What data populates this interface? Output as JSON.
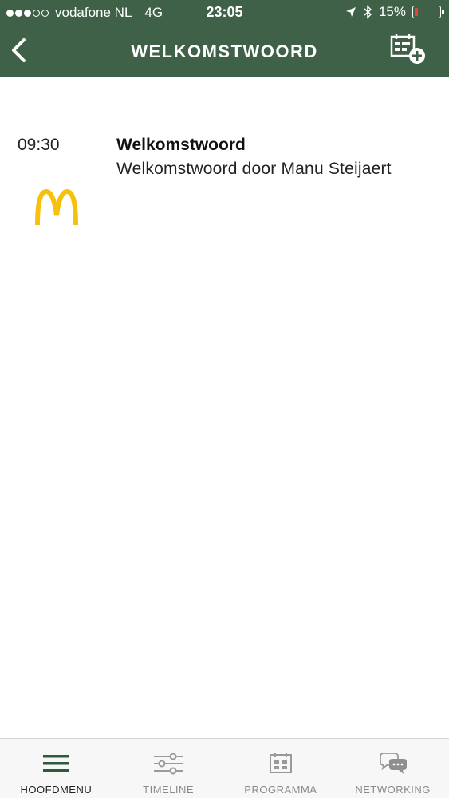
{
  "status": {
    "carrier": "vodafone NL",
    "network": "4G",
    "time": "23:05",
    "battery": "15%",
    "battery_level": 0.15,
    "signal_bars_filled": 3,
    "signal_bars_total": 5,
    "icons": [
      "location-arrow-icon",
      "bluetooth-icon",
      "battery-icon"
    ]
  },
  "nav": {
    "title": "WELKOMSTWOORD",
    "back_icon": "chevron-left-icon",
    "action_icon": "add-to-calendar-icon"
  },
  "session": {
    "time": "09:30",
    "title": "Welkomstwoord",
    "description": "Welkomstwoord door Manu Steijaert",
    "logo_icon": "mcdonalds-arches-logo",
    "logo_color": "#f6c10d"
  },
  "tabs": [
    {
      "label": "HOOFDMENU",
      "icon": "hamburger-menu-icon",
      "active": true
    },
    {
      "label": "TIMELINE",
      "icon": "sliders-icon",
      "active": false
    },
    {
      "label": "PROGRAMMA",
      "icon": "calendar-icon",
      "active": false
    },
    {
      "label": "NETWORKING",
      "icon": "chat-bubbles-icon",
      "active": false
    }
  ],
  "colors": {
    "header": "#3f6147",
    "active_tab_icon": "#2f5a3d",
    "inactive_tab": "#8a8a8a"
  }
}
